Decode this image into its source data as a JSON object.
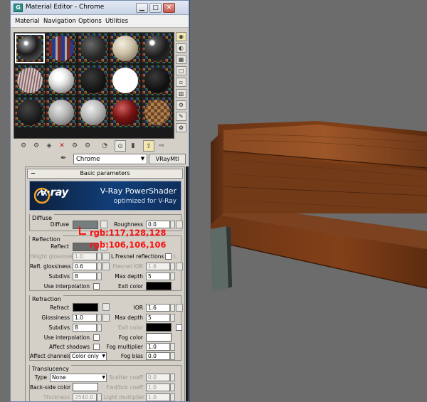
{
  "window": {
    "title": "Material Editor - Chrome",
    "app_icon": "3ds-max-icon"
  },
  "menu": [
    "Material",
    "Navigation",
    "Options",
    "Utilities"
  ],
  "toolbar_icons": [
    "get-material-icon",
    "put-to-scene-icon",
    "assign-material-icon",
    "reset-map-icon",
    "make-unique-icon",
    "put-to-library-icon",
    "material-id-icon",
    "show-map-icon",
    "show-end-result-icon",
    "go-to-parent-icon",
    "go-forward-sibling-icon"
  ],
  "material": {
    "name": "Chrome",
    "type": "VRayMtl"
  },
  "rollout": {
    "title": "Basic parameters",
    "collapse_sign": "−"
  },
  "banner": {
    "logo": "v·ray",
    "title": "V-Ray PowerShader",
    "subtitle": "optimized for V-Ray"
  },
  "diffuse": {
    "group": "Diffuse",
    "diffuse_label": "Diffuse",
    "diffuse_color": "#757f80",
    "roughness_label": "Roughness",
    "roughness_value": "0.0"
  },
  "reflection": {
    "group": "Reflection",
    "reflect_label": "Reflect",
    "reflect_color": "#6a6a6a",
    "hilight_label": "Hilight glossiness",
    "hilight_value": "1.0",
    "lock_label": "L",
    "fresnel_label": "Fresnel reflections",
    "refl_gloss_label": "Refl. glossiness",
    "refl_gloss_value": "0.6",
    "fresnel_ior_label": "Fresnel IOR",
    "fresnel_ior_value": "1.6",
    "subdivs_label": "Subdivs",
    "subdivs_value": "8",
    "max_depth_label": "Max depth",
    "max_depth_value": "5",
    "use_interp_label": "Use interpolation",
    "exit_color_label": "Exit color",
    "exit_color": "#000000"
  },
  "refraction": {
    "group": "Refraction",
    "refract_label": "Refract",
    "refract_color": "#000000",
    "ior_label": "IOR",
    "ior_value": "1.6",
    "gloss_label": "Glossiness",
    "gloss_value": "1.0",
    "max_depth_label": "Max depth",
    "max_depth_value": "5",
    "subdivs_label": "Subdivs",
    "subdivs_value": "8",
    "exit_color_label": "Exit color",
    "exit_color": "#000000",
    "use_interp_label": "Use interpolation",
    "fog_color_label": "Fog color",
    "fog_color": "#ffffff",
    "affect_shadows_label": "Affect shadows",
    "fog_mult_label": "Fog multiplier",
    "fog_mult_value": "1.0",
    "affect_channels_label": "Affect channels",
    "affect_channels_value": "Color only",
    "fog_bias_label": "Fog bias",
    "fog_bias_value": "0.0"
  },
  "translucency": {
    "group": "Translucency",
    "type_label": "Type",
    "type_value": "None",
    "scatter_label": "Scatter coeff",
    "scatter_value": "0.0",
    "backside_label": "Back-side color",
    "backside_color": "#ffffff",
    "fwdbck_label": "Fwd/bck coeff",
    "fwdbck_value": "1.0",
    "thickness_label": "Thickness",
    "thickness_value": "2540.0",
    "light_mult_label": "Light multiplier",
    "light_mult_value": "1.0"
  },
  "annotations": {
    "diffuse_rgb": "rgb:117,128,128",
    "reflect_rgb": "rgb:106,106,106"
  }
}
